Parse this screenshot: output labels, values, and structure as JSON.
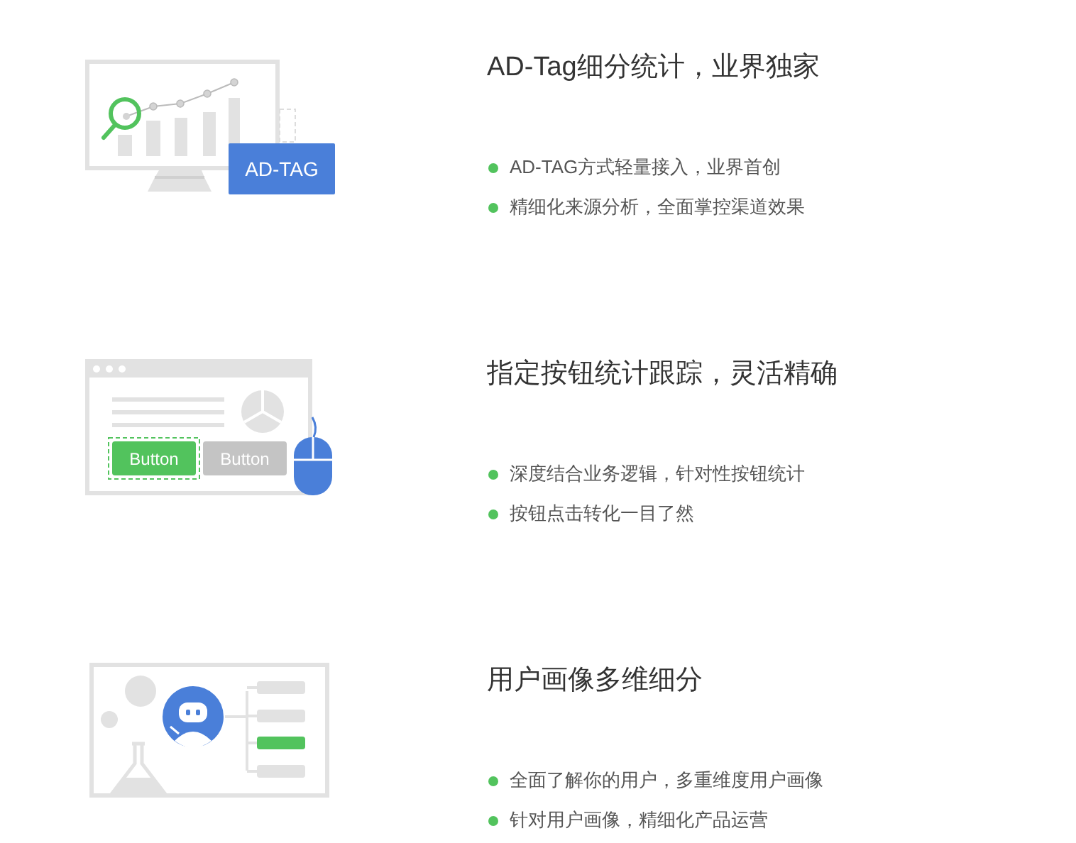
{
  "features": [
    {
      "kind": "adtag",
      "title": "AD-Tag细分统计，业界独家",
      "labels": [
        "AD-TAG"
      ],
      "points": [
        "AD-TAG方式轻量接入，业界首创",
        "精细化来源分析，全面掌控渠道效果"
      ]
    },
    {
      "kind": "button",
      "title": "指定按钮统计跟踪，灵活精确",
      "labels": [
        "Button",
        "Button"
      ],
      "points": [
        "深度结合业务逻辑，针对性按钮统计",
        "按钮点击转化一目了然"
      ]
    },
    {
      "kind": "profile",
      "title": "用户画像多维细分",
      "points": [
        "全面了解你的用户，多重维度用户画像",
        "针对用户画像，精细化产品运营"
      ]
    }
  ]
}
